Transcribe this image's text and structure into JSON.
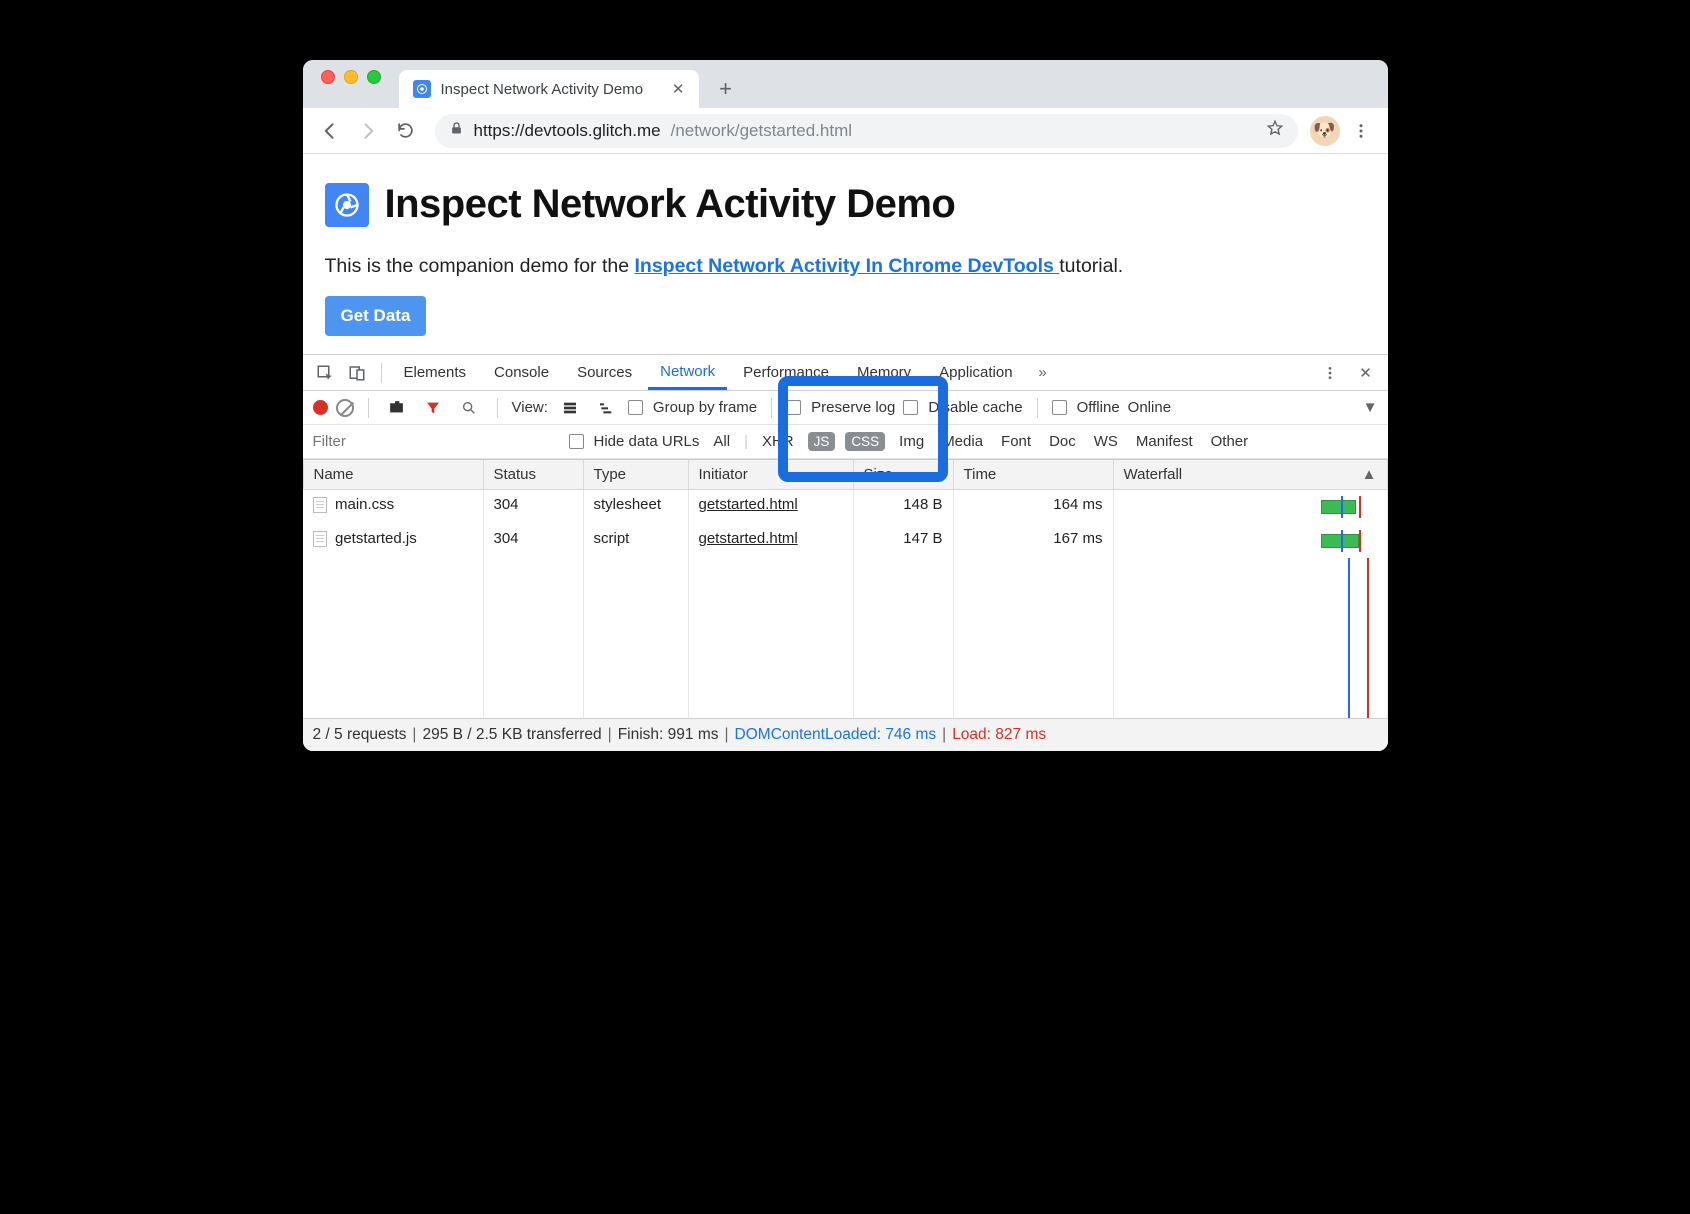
{
  "browser": {
    "tab_title": "Inspect Network Activity Demo",
    "url_host": "https://devtools.glitch.me",
    "url_path": "/network/getstarted.html"
  },
  "page": {
    "heading": "Inspect Network Activity Demo",
    "intro_pre": "This is the companion demo for the ",
    "intro_link": "Inspect Network Activity In Chrome DevTools ",
    "intro_post": "tutorial.",
    "button": "Get Data"
  },
  "devtools": {
    "tabs": [
      "Elements",
      "Console",
      "Sources",
      "Network",
      "Performance",
      "Memory",
      "Application"
    ],
    "active_tab": "Network",
    "toolbar": {
      "view_label": "View:",
      "group_by_frame": "Group by frame",
      "preserve_log": "Preserve log",
      "disable_cache": "Disable cache",
      "offline": "Offline",
      "online": "Online"
    },
    "filter": {
      "placeholder": "Filter",
      "hide_urls": "Hide data URLs",
      "types": [
        "All",
        "XHR",
        "JS",
        "CSS",
        "Img",
        "Media",
        "Font",
        "Doc",
        "WS",
        "Manifest",
        "Other"
      ],
      "selected": [
        "JS",
        "CSS"
      ]
    },
    "columns": [
      "Name",
      "Status",
      "Type",
      "Initiator",
      "Size",
      "Time",
      "Waterfall"
    ],
    "rows": [
      {
        "name": "main.css",
        "status": "304",
        "type": "stylesheet",
        "initiator": "getstarted.html",
        "size": "148 B",
        "time": "164 ms"
      },
      {
        "name": "getstarted.js",
        "status": "304",
        "type": "script",
        "initiator": "getstarted.html",
        "size": "147 B",
        "time": "167 ms"
      }
    ],
    "status": {
      "requests": "2 / 5 requests",
      "transferred": "295 B / 2.5 KB transferred",
      "finish": "Finish: 991 ms",
      "dcl": "DOMContentLoaded: 746 ms",
      "load": "Load: 827 ms"
    }
  }
}
